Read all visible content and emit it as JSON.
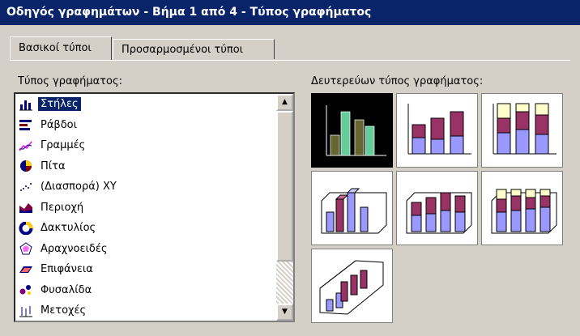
{
  "window": {
    "title": "Οδηγός γραφημάτων - Βήμα 1 από 4 - Τύπος γραφήματος"
  },
  "tabs": [
    {
      "label": "Βασικοί τύποι",
      "active": true
    },
    {
      "label": "Προσαρμοσμένοι τύποι",
      "active": false
    }
  ],
  "chart_type": {
    "label": "Τύπος γραφήματος:",
    "items": [
      {
        "label": "Στήλες",
        "icon": "column-chart-icon",
        "selected": true
      },
      {
        "label": "Ράβδοι",
        "icon": "bar-chart-icon"
      },
      {
        "label": "Γραμμές",
        "icon": "line-chart-icon"
      },
      {
        "label": "Πίτα",
        "icon": "pie-chart-icon"
      },
      {
        "label": "(Διασπορά) XY",
        "icon": "scatter-chart-icon"
      },
      {
        "label": "Περιοχή",
        "icon": "area-chart-icon"
      },
      {
        "label": "Δακτυλίος",
        "icon": "doughnut-chart-icon"
      },
      {
        "label": "Αραχνοειδές",
        "icon": "radar-chart-icon"
      },
      {
        "label": "Επιφάνεια",
        "icon": "surface-chart-icon"
      },
      {
        "label": "Φυσαλίδα",
        "icon": "bubble-chart-icon"
      },
      {
        "label": "Μετοχές",
        "icon": "stock-chart-icon"
      }
    ]
  },
  "subtype": {
    "label": "Δευτερεύων τύπος γραφήματος:",
    "selected_index": 0
  },
  "colors": {
    "titlebar": "#0a246a",
    "purple": "#993366",
    "blue": "#9999ff",
    "cream": "#ffffcc",
    "olive": "#666633",
    "teal": "#66cc99"
  }
}
